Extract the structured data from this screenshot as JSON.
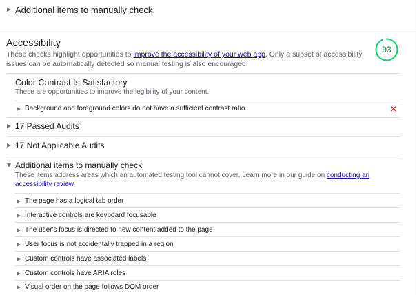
{
  "top_group": {
    "label": "Additional items to manually check"
  },
  "category": {
    "title": "Accessibility",
    "description_before": "These checks highlight opportunities to ",
    "description_link": "improve the accessibility of your web app",
    "description_after": ". Only a subset of accessibility issues can be automatically detected so manual testing is also encouraged.",
    "score": "93",
    "score_color": "#0cce6b"
  },
  "contrast_group": {
    "title": "Color Contrast Is Satisfactory",
    "description": "These are opportunities to improve the legibility of your content.",
    "audit": "Background and foreground colors do not have a sufficient contrast ratio.",
    "fail_color": "#eb0f00"
  },
  "passed": {
    "label": "17 Passed Audits"
  },
  "not_applicable": {
    "label": "17 Not Applicable Audits"
  },
  "manual": {
    "title": "Additional items to manually check",
    "description_before": "These items address areas which an automated testing tool cannot cover. Learn more in our guide on ",
    "description_link": "conducting an accessibility review",
    "items": [
      "The page has a logical tab order",
      "Interactive controls are keyboard focusable",
      "The user's focus is directed to new content added to the page",
      "User focus is not accidentally trapped in a region",
      "Custom controls have associated labels",
      "Custom controls have ARIA roles",
      "Visual order on the page follows DOM order"
    ]
  }
}
